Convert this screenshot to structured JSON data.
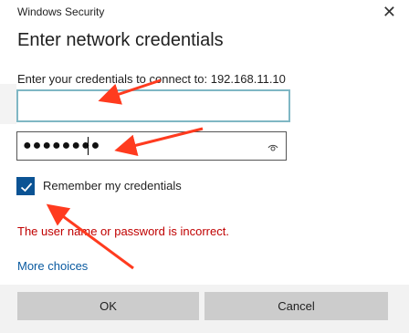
{
  "window": {
    "title": "Windows Security",
    "close_icon": "close-icon"
  },
  "dialog": {
    "heading": "Enter network credentials",
    "prompt": "Enter your credentials to connect to: 192.168.11.10"
  },
  "fields": {
    "username_value": "",
    "password_masked": "●●●●●●●●",
    "password_reveal_icon": "eye-icon"
  },
  "remember": {
    "checked": true,
    "label": "Remember my credentials"
  },
  "error": {
    "message": "The user name or password is incorrect."
  },
  "links": {
    "more_choices": "More choices"
  },
  "buttons": {
    "ok": "OK",
    "cancel": "Cancel"
  },
  "colors": {
    "accent": "#0b5394",
    "error": "#c00000",
    "link": "#0a5aa0",
    "annotation_arrow": "#ff3b1f"
  }
}
